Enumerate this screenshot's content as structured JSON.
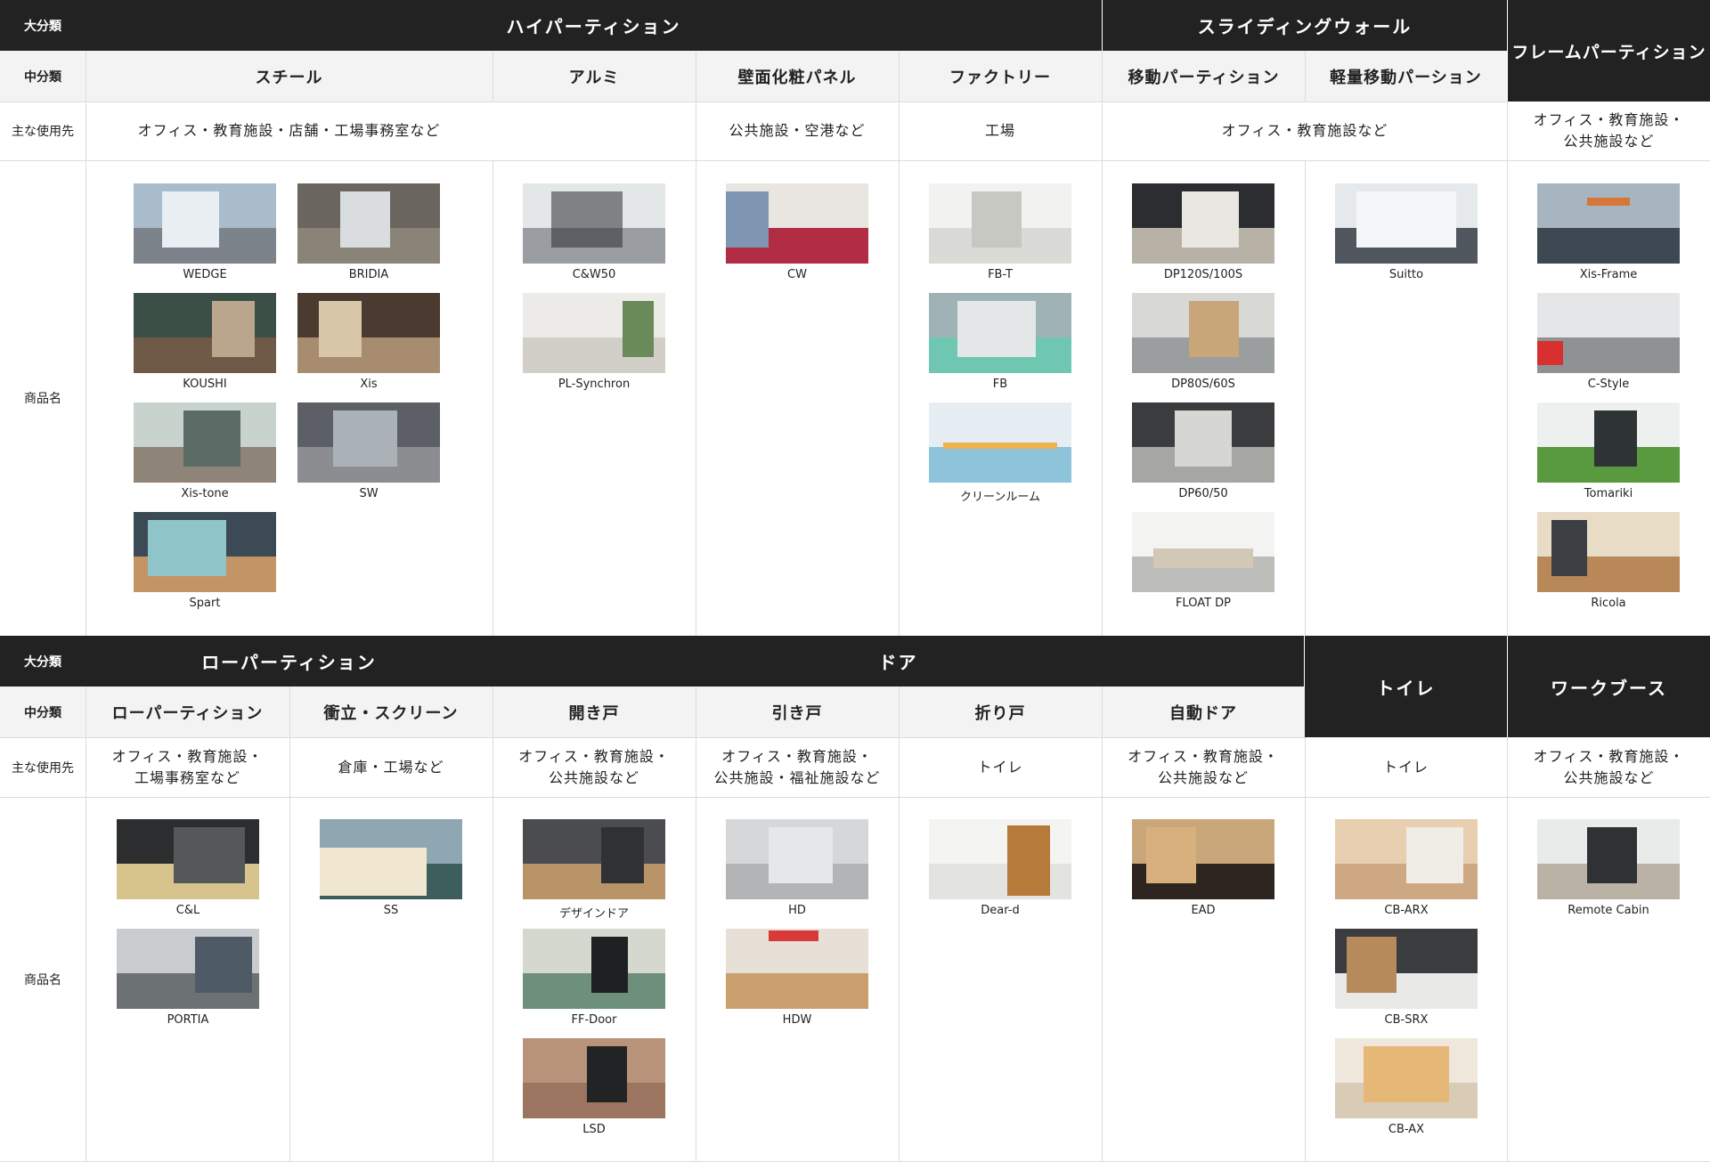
{
  "row_labels": {
    "major": "大分類",
    "middle": "中分類",
    "usage": "主な使用先",
    "products": "商品名"
  },
  "sec1": {
    "cat_hyper": "ハイパーティション",
    "cat_sliding": "スライディングウォール",
    "cat_frame": "フレームパーティション",
    "sub_steel": "スチール",
    "sub_alumi": "アルミ",
    "sub_wall": "壁面化粧パネル",
    "sub_factory": "ファクトリー",
    "sub_move": "移動パーティション",
    "sub_light": "軽量移動パーション",
    "use_steel": "オフィス・教育施設・店舗・工場事務室など",
    "use_wall": "公共施設・空港など",
    "use_factory": "工場",
    "use_sliding": "オフィス・教育施設など",
    "use_frame_1": "オフィス・教育施設・",
    "use_frame_2": "公共施設など"
  },
  "sec2": {
    "cat_low": "ローパーティション",
    "cat_door": "ドア",
    "cat_toilet": "トイレ",
    "cat_booth": "ワークブース",
    "sub_low": "ローパーティション",
    "sub_screen": "衝立・スクリーン",
    "sub_open": "開き戸",
    "sub_slide": "引き戸",
    "sub_fold": "折り戸",
    "sub_auto": "自動ドア",
    "use_low_1": "オフィス・教育施設・",
    "use_low_2": "工場事務室など",
    "use_screen": "倉庫・工場など",
    "use_open_1": "オフィス・教育施設・",
    "use_open_2": "公共施設など",
    "use_slide_1": "オフィス・教育施設・",
    "use_slide_2": "公共施設・福祉施設など",
    "use_fold": "トイレ",
    "use_auto_1": "オフィス・教育施設・",
    "use_auto_2": "公共施設など",
    "use_toilet": "トイレ",
    "use_booth_1": "オフィス・教育施設・",
    "use_booth_2": "公共施設など"
  },
  "products": {
    "wedge": "WEDGE",
    "bridia": "BRIDIA",
    "koushi": "KOUSHI",
    "xis": "Xis",
    "xistone": "Xis-tone",
    "sw": "SW",
    "spart": "Spart",
    "cw50": "C&W50",
    "plsync": "PL-Synchron",
    "cw": "CW",
    "fbt": "FB-T",
    "fb": "FB",
    "clean": "クリーンルーム",
    "dp120": "DP120S/100S",
    "dp80": "DP80S/60S",
    "dp60": "DP60/50",
    "floatdp": "FLOAT DP",
    "suitto": "Suitto",
    "xisframe": "Xis-Frame",
    "cstyle": "C-Style",
    "tomariki": "Tomariki",
    "ricola": "Ricola",
    "cl": "C&L",
    "portia": "PORTIA",
    "ss": "SS",
    "design": "デザインドア",
    "ffdoor": "FF-Door",
    "lsd": "LSD",
    "hd": "HD",
    "hdw": "HDW",
    "deard": "Dear-d",
    "ead": "EAD",
    "cbarx": "CB-ARX",
    "cbsrx": "CB-SRX",
    "cbax": "CB-AX",
    "remote": "Remote Cabin"
  },
  "colors": {
    "header_dark": "#222222",
    "header_light": "#f3f3f3",
    "grid_line": "#dcdcdc"
  }
}
